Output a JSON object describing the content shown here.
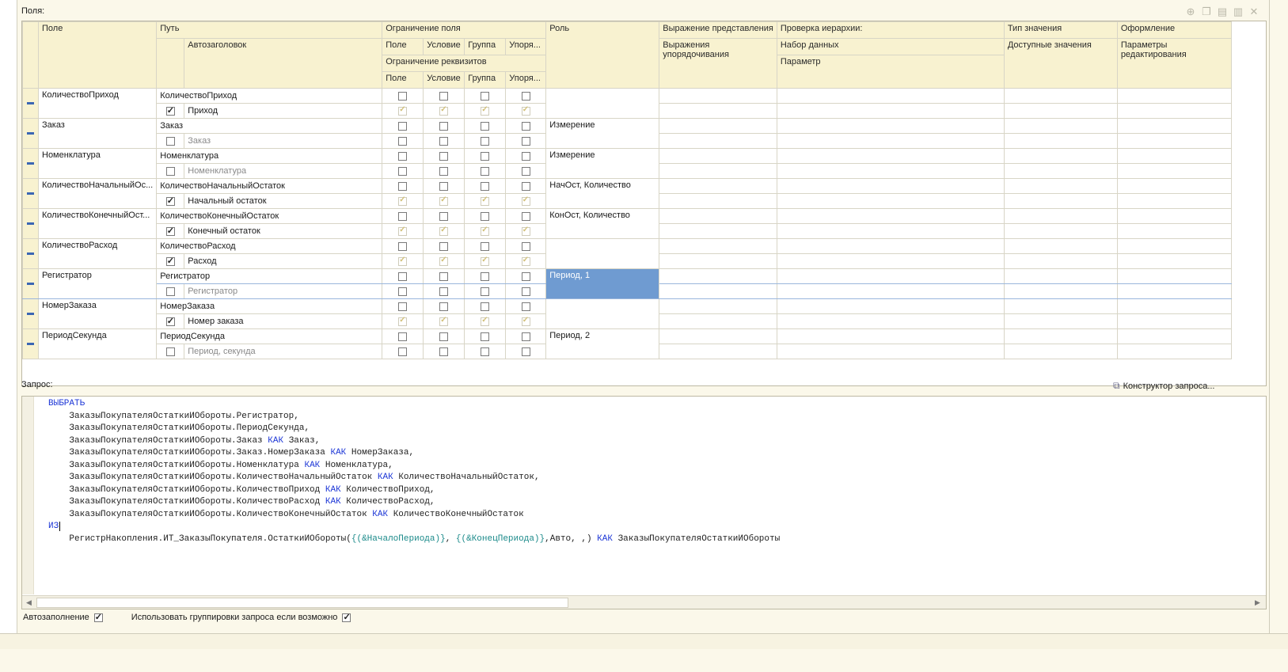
{
  "fields_label": "Поля:",
  "query_label": "Запрос:",
  "constructor_label": "Конструктор запроса...",
  "toolbar": {
    "icons": [
      "add-icon",
      "copy-icon",
      "add-folder-icon",
      "folder-icon",
      "delete-icon"
    ]
  },
  "headers": {
    "field": "Поле",
    "path": "Путь",
    "autotitle": "Автозаголовок",
    "field_restriction": "Ограничение поля",
    "fr_field": "Поле",
    "fr_condition": "Условие",
    "fr_group": "Группа",
    "fr_order": "Упоря...",
    "attr_restriction": "Ограничение реквизитов",
    "ar_field": "Поле",
    "ar_condition": "Условие",
    "ar_group": "Группа",
    "ar_order": "Упоря...",
    "role": "Роль",
    "presentation_expr": "Выражение представления",
    "order_expr": "Выражения упорядочивания",
    "hierarchy_check": "Проверка иерархии:",
    "dataset": "Набор данных",
    "parameter": "Параметр",
    "value_type": "Тип значения",
    "available_values": "Доступные значения",
    "appearance": "Оформление",
    "edit_params": "Параметры редактирования"
  },
  "rows": [
    {
      "field": "КоличествоПриход",
      "path": "КоличествоПриход",
      "autotitle_checked": true,
      "title": "Приход",
      "title_dim": false,
      "role": "",
      "selected": false
    },
    {
      "field": "Заказ",
      "path": "Заказ",
      "autotitle_checked": false,
      "title": "Заказ",
      "title_dim": true,
      "role": "Измерение",
      "selected": false
    },
    {
      "field": "Номенклатура",
      "path": "Номенклатура",
      "autotitle_checked": false,
      "title": "Номенклатура",
      "title_dim": true,
      "role": "Измерение",
      "selected": false
    },
    {
      "field": "КоличествоНачальныйОс...",
      "path": "КоличествоНачальныйОстаток",
      "autotitle_checked": true,
      "title": "Начальный остаток",
      "title_dim": false,
      "role": "НачОст, Количество",
      "selected": false
    },
    {
      "field": "КоличествоКонечныйОст...",
      "path": "КоличествоКонечныйОстаток",
      "autotitle_checked": true,
      "title": "Конечный остаток",
      "title_dim": false,
      "role": "КонОст, Количество",
      "selected": false
    },
    {
      "field": "КоличествоРасход",
      "path": "КоличествоРасход",
      "autotitle_checked": true,
      "title": "Расход",
      "title_dim": false,
      "role": "",
      "selected": false
    },
    {
      "field": "Регистратор",
      "path": "Регистратор",
      "autotitle_checked": false,
      "title": "Регистратор",
      "title_dim": true,
      "role": "Период, 1",
      "selected": true
    },
    {
      "field": "НомерЗаказа",
      "path": "НомерЗаказа",
      "autotitle_checked": true,
      "title": "Номер заказа",
      "title_dim": false,
      "role": "",
      "selected": false
    },
    {
      "field": "ПериодСекунда",
      "path": "ПериодСекунда",
      "autotitle_checked": false,
      "title": "Период, секунда",
      "title_dim": true,
      "role": "Период, 2",
      "selected": false
    }
  ],
  "query": {
    "kw_select": "ВЫБРАТЬ",
    "kw_as": "КАК",
    "kw_from": "ИЗ",
    "lines": [
      {
        "pre": "ЗаказыПокупателяОстаткиИОбороты.Регистратор,"
      },
      {
        "pre": "ЗаказыПокупателяОстаткиИОбороты.ПериодСекунда,"
      },
      {
        "pre": "ЗаказыПокупателяОстаткиИОбороты.Заказ",
        "alias": "Заказ,"
      },
      {
        "pre": "ЗаказыПокупателяОстаткиИОбороты.Заказ.НомерЗаказа",
        "alias": "НомерЗаказа,"
      },
      {
        "pre": "ЗаказыПокупателяОстаткиИОбороты.Номенклатура",
        "alias": "Номенклатура,"
      },
      {
        "pre": "ЗаказыПокупателяОстаткиИОбороты.КоличествоНачальныйОстаток",
        "alias": "КоличествоНачальныйОстаток,"
      },
      {
        "pre": "ЗаказыПокупателяОстаткиИОбороты.КоличествоПриход",
        "alias": "КоличествоПриход,"
      },
      {
        "pre": "ЗаказыПокупателяОстаткиИОбороты.КоличествоРасход",
        "alias": "КоличествоРасход,"
      },
      {
        "pre": "ЗаказыПокупателяОстаткиИОбороты.КоличествоКонечныйОстаток",
        "alias": "КоличествоКонечныйОстаток"
      }
    ],
    "from_prefix": "РегистрНакопления.ИТ_ЗаказыПокупателя.ОстаткиИОбороты(",
    "from_p1": "{(&НачалоПериода)}",
    "from_mid": ", ",
    "from_p2": "{(&КонецПериода)}",
    "from_rest": ",Авто, ,",
    "from_close": ")",
    "from_alias": "ЗаказыПокупателяОстаткиИОбороты"
  },
  "bottom": {
    "autofill_label": "Автозаполнение",
    "autofill_checked": true,
    "use_groupings_label": "Использовать группировки запроса если возможно",
    "use_groupings_checked": true
  }
}
